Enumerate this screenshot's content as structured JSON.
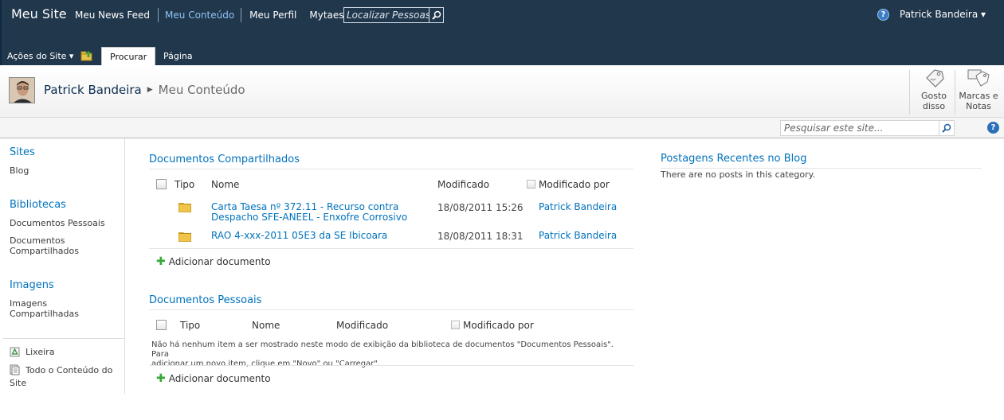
{
  "topbar": {
    "site_title": "Meu Site",
    "nav": [
      "Meu News Feed",
      "Meu Conteúdo",
      "Meu Perfil",
      "Mytaesa"
    ],
    "people_search_placeholder": "Localizar Pessoas",
    "help": "?",
    "user": "Patrick Bandeira ▾"
  },
  "ribbon": {
    "site_actions": "Ações do Site ▾",
    "tabs": [
      "Procurar",
      "Página"
    ]
  },
  "titlearea": {
    "breadcrumb_root": "Patrick Bandeira",
    "breadcrumb_sep": "▶",
    "breadcrumb_current": "Meu Conteúdo",
    "like_label_1": "Gosto",
    "like_label_2": "disso",
    "tags_label_1": "Marcas e",
    "tags_label_2": "Notas"
  },
  "search": {
    "placeholder": "Pesquisar este site...",
    "help": "?"
  },
  "leftnav": {
    "sites_heading": "Sites",
    "blog": "Blog",
    "libraries_heading": "Bibliotecas",
    "lib_personal": "Documentos Pessoais",
    "lib_shared_1": "Documentos",
    "lib_shared_2": "Compartilhados",
    "images_heading": "Imagens",
    "img_shared_1": "Imagens",
    "img_shared_2": "Compartilhadas",
    "recycle": "Lixeira",
    "all_content_1": "Todo o Conteúdo do",
    "all_content_2": "Site"
  },
  "shared_docs": {
    "title": "Documentos Compartilhados",
    "col_type": "Tipo",
    "col_name": "Nome",
    "col_modified": "Modificado",
    "col_modified_by": "Modificado por",
    "rows": [
      {
        "name_1": "Carta Taesa nº 372.11 - Recurso contra",
        "name_2": "Despacho SFE-ANEEL - Enxofre Corrosivo",
        "modified": "18/08/2011 15:26",
        "modified_by": "Patrick Bandeira"
      },
      {
        "name_1": "RAO 4-xxx-2011 05E3 da SE Ibicoara",
        "name_2": "",
        "modified": "18/08/2011 18:31",
        "modified_by": "Patrick Bandeira"
      }
    ],
    "add_doc": "Adicionar documento"
  },
  "personal_docs": {
    "title": "Documentos Pessoais",
    "col_type": "Tipo",
    "col_name": "Nome",
    "col_modified": "Modificado",
    "col_modified_by": "Modificado por",
    "empty_1": "Não há nenhum item a ser mostrado neste modo de exibição da biblioteca de documentos \"Documentos Pessoais\". Para",
    "empty_2": "adicionar um novo item, clique em \"Novo\" ou \"Carregar\".",
    "add_doc": "Adicionar documento"
  },
  "blog": {
    "title": "Postagens Recentes no Blog",
    "empty": "There are no posts in this category."
  }
}
